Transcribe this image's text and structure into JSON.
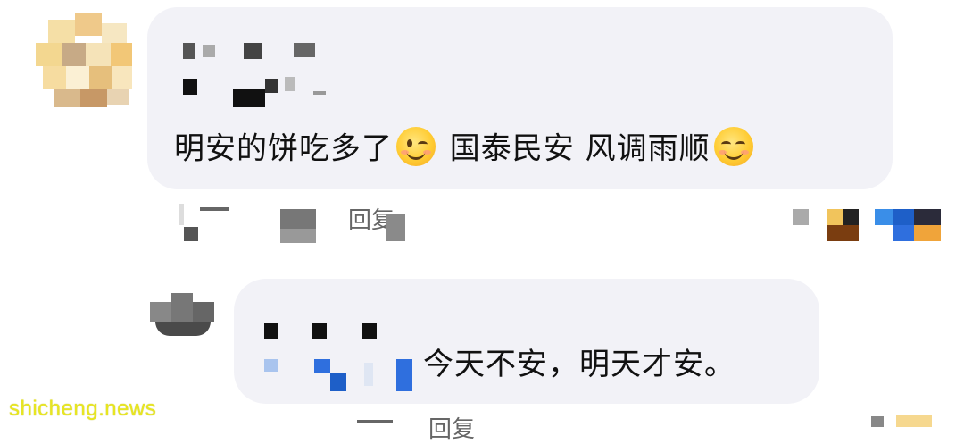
{
  "comments": [
    {
      "text_before_emoji": "明安的饼吃多了",
      "emoji_1": "winking-face-icon",
      "text_after_emoji": " 国泰民安 风调雨顺",
      "emoji_2": "smiling-face-icon",
      "reply_label": "回复"
    },
    {
      "text": "今天不安，明天才安。",
      "reply_label": "回复"
    }
  ],
  "watermark": "shicheng.news",
  "colors": {
    "bubble": "#f2f2f7",
    "text": "#111111",
    "watermark": "#e8e620",
    "pixel_blue": "#2f6fde"
  }
}
